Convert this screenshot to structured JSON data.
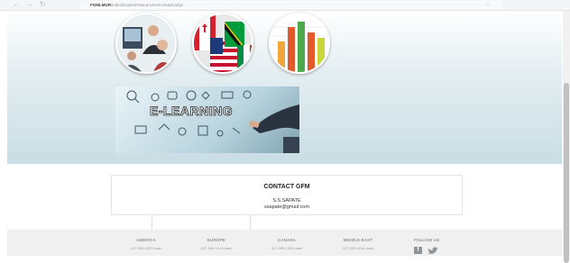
{
  "browser": {
    "back": "←",
    "forward": "→",
    "reload": "↻",
    "url_host": "FGMLMUR",
    "url_rest": "/index/Explorer/Vacancies/ContactUs/gs"
  },
  "hero": {
    "circles": [
      {
        "name": "people-meeting-image"
      },
      {
        "name": "flags-image"
      },
      {
        "name": "bar-chart-image"
      }
    ],
    "banner_title": "E-LEARNING"
  },
  "contact": {
    "title": "CONTACT GFM",
    "name": "S.S.SAPATE",
    "email": "ssapate@gmail.com"
  },
  "footer": {
    "regions": [
      {
        "name": "AMERICA",
        "phone": "417-390-1003 main"
      },
      {
        "name": "EUROPE",
        "phone": "417-390-1014 main"
      },
      {
        "name": "CANADA",
        "phone": "417-390-1003 main"
      },
      {
        "name": "MIDDLE EAST",
        "phone": "417-390-1014 main"
      }
    ],
    "follow_label": "FOLLOW US",
    "social_icons": [
      "facebook-icon",
      "twitter-icon"
    ]
  }
}
